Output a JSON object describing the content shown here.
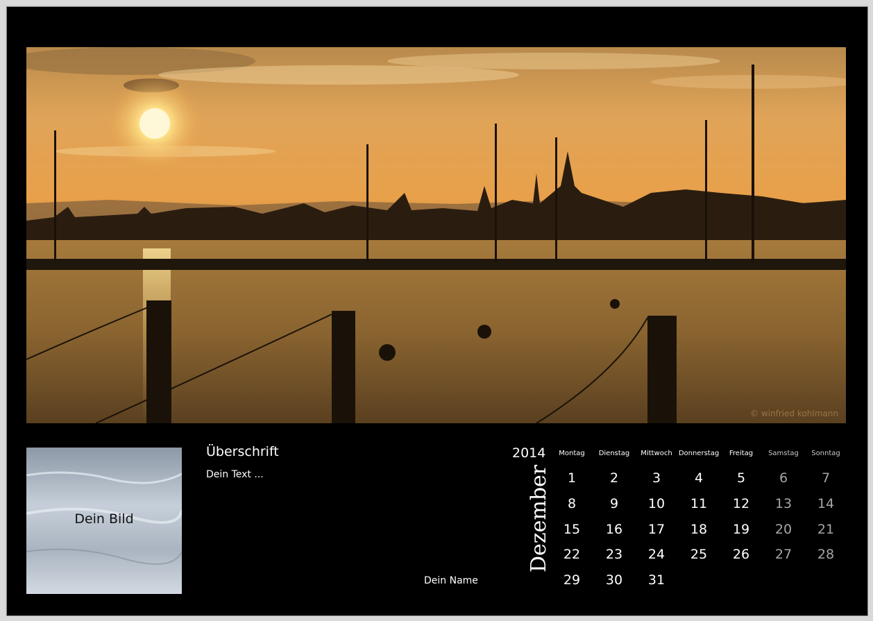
{
  "photo": {
    "subject": "harbor-sunset",
    "credit": "© winfried kohlmann",
    "colors": {
      "sky": "#e8a04a",
      "water": "#8a6430",
      "silhouette": "#1a1208"
    }
  },
  "thumbnail": {
    "label": "Dein Bild"
  },
  "text": {
    "heading": "Überschrift",
    "body": "Dein Text ...",
    "author": "Dein Name"
  },
  "calendar": {
    "year": "2014",
    "month": "Dezember",
    "weekdays": [
      "Montag",
      "Dienstag",
      "Mittwoch",
      "Donnerstag",
      "Freitag",
      "Samstag",
      "Sonntag"
    ],
    "weeks": [
      [
        "1",
        "2",
        "3",
        "4",
        "5",
        "6",
        "7"
      ],
      [
        "8",
        "9",
        "10",
        "11",
        "12",
        "13",
        "14"
      ],
      [
        "15",
        "16",
        "17",
        "18",
        "19",
        "20",
        "21"
      ],
      [
        "22",
        "23",
        "24",
        "25",
        "26",
        "27",
        "28"
      ],
      [
        "29",
        "30",
        "31",
        "",
        "",
        "",
        ""
      ]
    ]
  }
}
